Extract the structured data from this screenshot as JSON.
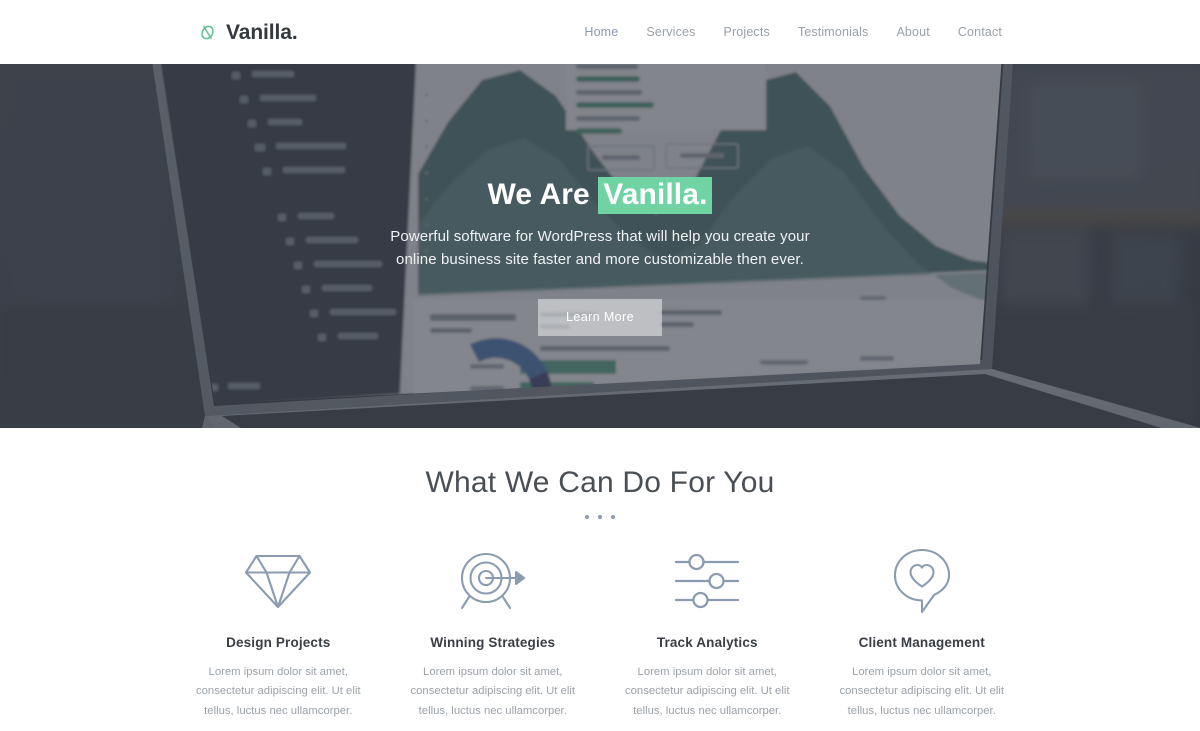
{
  "header": {
    "brand": {
      "name": "Vanilla.",
      "icon": "leaf-logo-icon",
      "accent": "#5cbd8e"
    },
    "nav": [
      {
        "label": "Home",
        "active": true
      },
      {
        "label": "Services",
        "active": false
      },
      {
        "label": "Projects",
        "active": false
      },
      {
        "label": "Testimonials",
        "active": false
      },
      {
        "label": "About",
        "active": false
      },
      {
        "label": "Contact",
        "active": false
      }
    ]
  },
  "hero": {
    "title_prefix": "We Are ",
    "title_highlight": "Vanilla.",
    "highlight_color": "#6fd3a4",
    "subtitle": "Powerful software for WordPress that will help you create your online business site faster and more customizable then ever.",
    "cta_label": "Learn More",
    "background": {
      "description": "laptop-dashboard-photo",
      "overlay_color": "rgba(55,60,70,0.62)"
    }
  },
  "features": {
    "section_title": "What We Can Do For You",
    "divider": "three-dots",
    "items": [
      {
        "icon": "diamond-icon",
        "title": "Design Projects",
        "text": "Lorem ipsum dolor sit amet, consectetur adipiscing elit. Ut elit tellus, luctus nec ullamcorper."
      },
      {
        "icon": "target-arrow-icon",
        "title": "Winning Strategies",
        "text": "Lorem ipsum dolor sit amet, consectetur adipiscing elit. Ut elit tellus, luctus nec ullamcorper."
      },
      {
        "icon": "sliders-icon",
        "title": "Track Analytics",
        "text": "Lorem ipsum dolor sit amet, consectetur adipiscing elit. Ut elit tellus, luctus nec ullamcorper."
      },
      {
        "icon": "chat-heart-icon",
        "title": "Client Management",
        "text": "Lorem ipsum dolor sit amet, consectetur adipiscing elit. Ut elit tellus, luctus nec ullamcorper."
      }
    ],
    "icon_color": "#8b9cb0"
  }
}
